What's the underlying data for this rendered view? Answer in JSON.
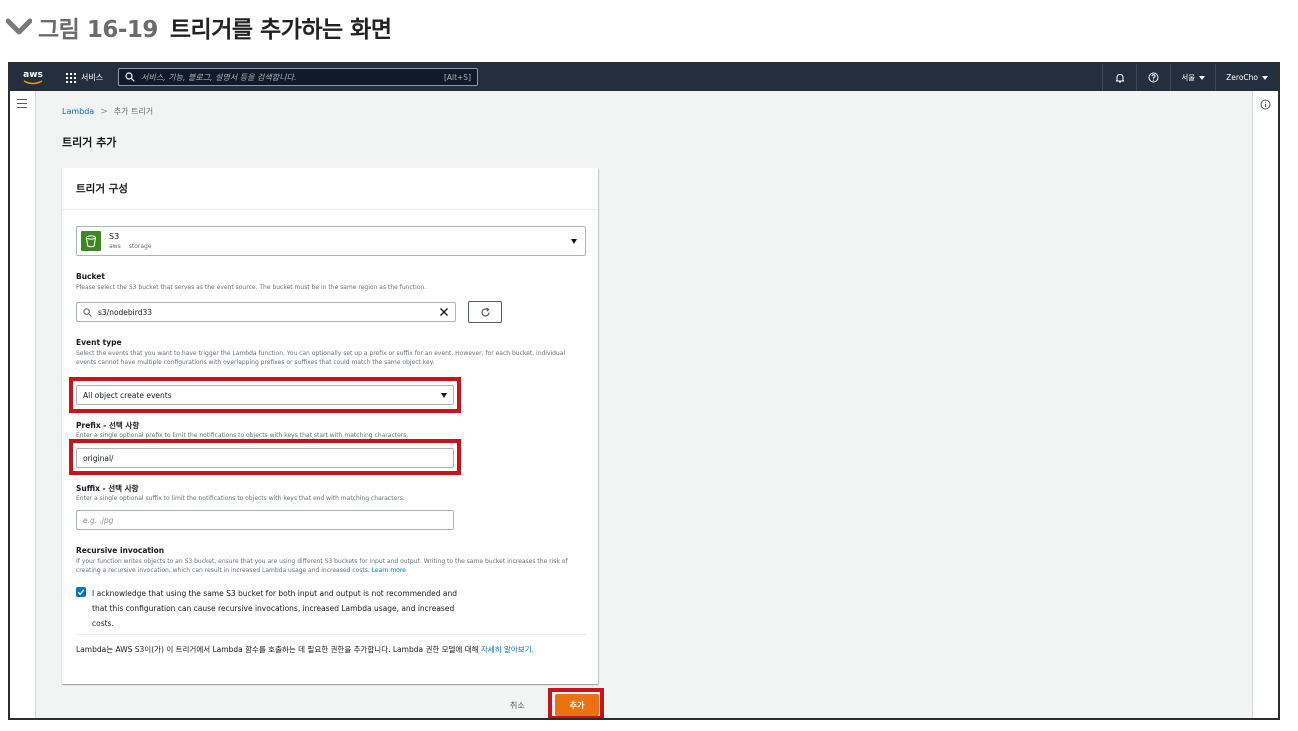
{
  "figure": {
    "label": "그림 16-19",
    "title": "트리거를 추가하는 화면"
  },
  "topnav": {
    "logo": "aws",
    "services_label": "서비스",
    "search_placeholder": "서비스, 기능, 블로그, 설명서 등을 검색합니다.",
    "search_shortcut": "[Alt+S]",
    "region": "서울",
    "account": "ZeroCho"
  },
  "breadcrumb": {
    "parent": "Lambda",
    "current": "추가 트리거"
  },
  "page": {
    "title": "트리거 추가"
  },
  "panel": {
    "title": "트리거 구성",
    "source": {
      "name": "S3",
      "tags": [
        "aws",
        "storage"
      ]
    },
    "bucket": {
      "label": "Bucket",
      "description": "Please select the S3 bucket that serves as the event source. The bucket must be in the same region as the function.",
      "value": "s3/nodebird33"
    },
    "event_type": {
      "label": "Event type",
      "description": "Select the events that you want to have trigger the Lambda function. You can optionally set up a prefix or suffix for an event. However, for each bucket, individual events cannot have multiple configurations with overlapping prefixes or suffixes that could match the same object key.",
      "value": "All object create events"
    },
    "prefix": {
      "label": "Prefix - 선택 사항",
      "description": "Enter a single optional prefix to limit the notifications to objects with keys that start with matching characters.",
      "value": "original/"
    },
    "suffix": {
      "label": "Suffix - 선택 사항",
      "description": "Enter a single optional suffix to limit the notifications to objects with keys that end with matching characters.",
      "placeholder": "e.g. .jpg"
    },
    "recursive": {
      "label": "Recursive invocation",
      "description": "If your function writes objects to an S3 bucket, ensure that you are using different S3 buckets for input and output. Writing to the same bucket increases the risk of creating a recursive invocation, which can result in increased Lambda usage and increased costs.",
      "learn_more": "Learn more",
      "acknowledge": "I acknowledge that using the same S3 bucket for both input and output is not recommended and that this configuration can cause recursive invocations, increased Lambda usage, and increased costs.",
      "checked": true
    },
    "notice": {
      "text": "Lambda는 AWS S3이(가) 이 트리거에서 Lambda 함수를 호출하는 데 필요한 권한을 추가합니다. Lambda 권한 모델에 대해",
      "link": "자세히 알아보기."
    }
  },
  "actions": {
    "cancel": "취소",
    "add": "추가"
  },
  "colors": {
    "nav_bg": "#232f3e",
    "accent_orange": "#ec7211",
    "highlight_red": "#c5141c",
    "link_blue": "#0073bb",
    "s3_green": "#3f8624"
  }
}
